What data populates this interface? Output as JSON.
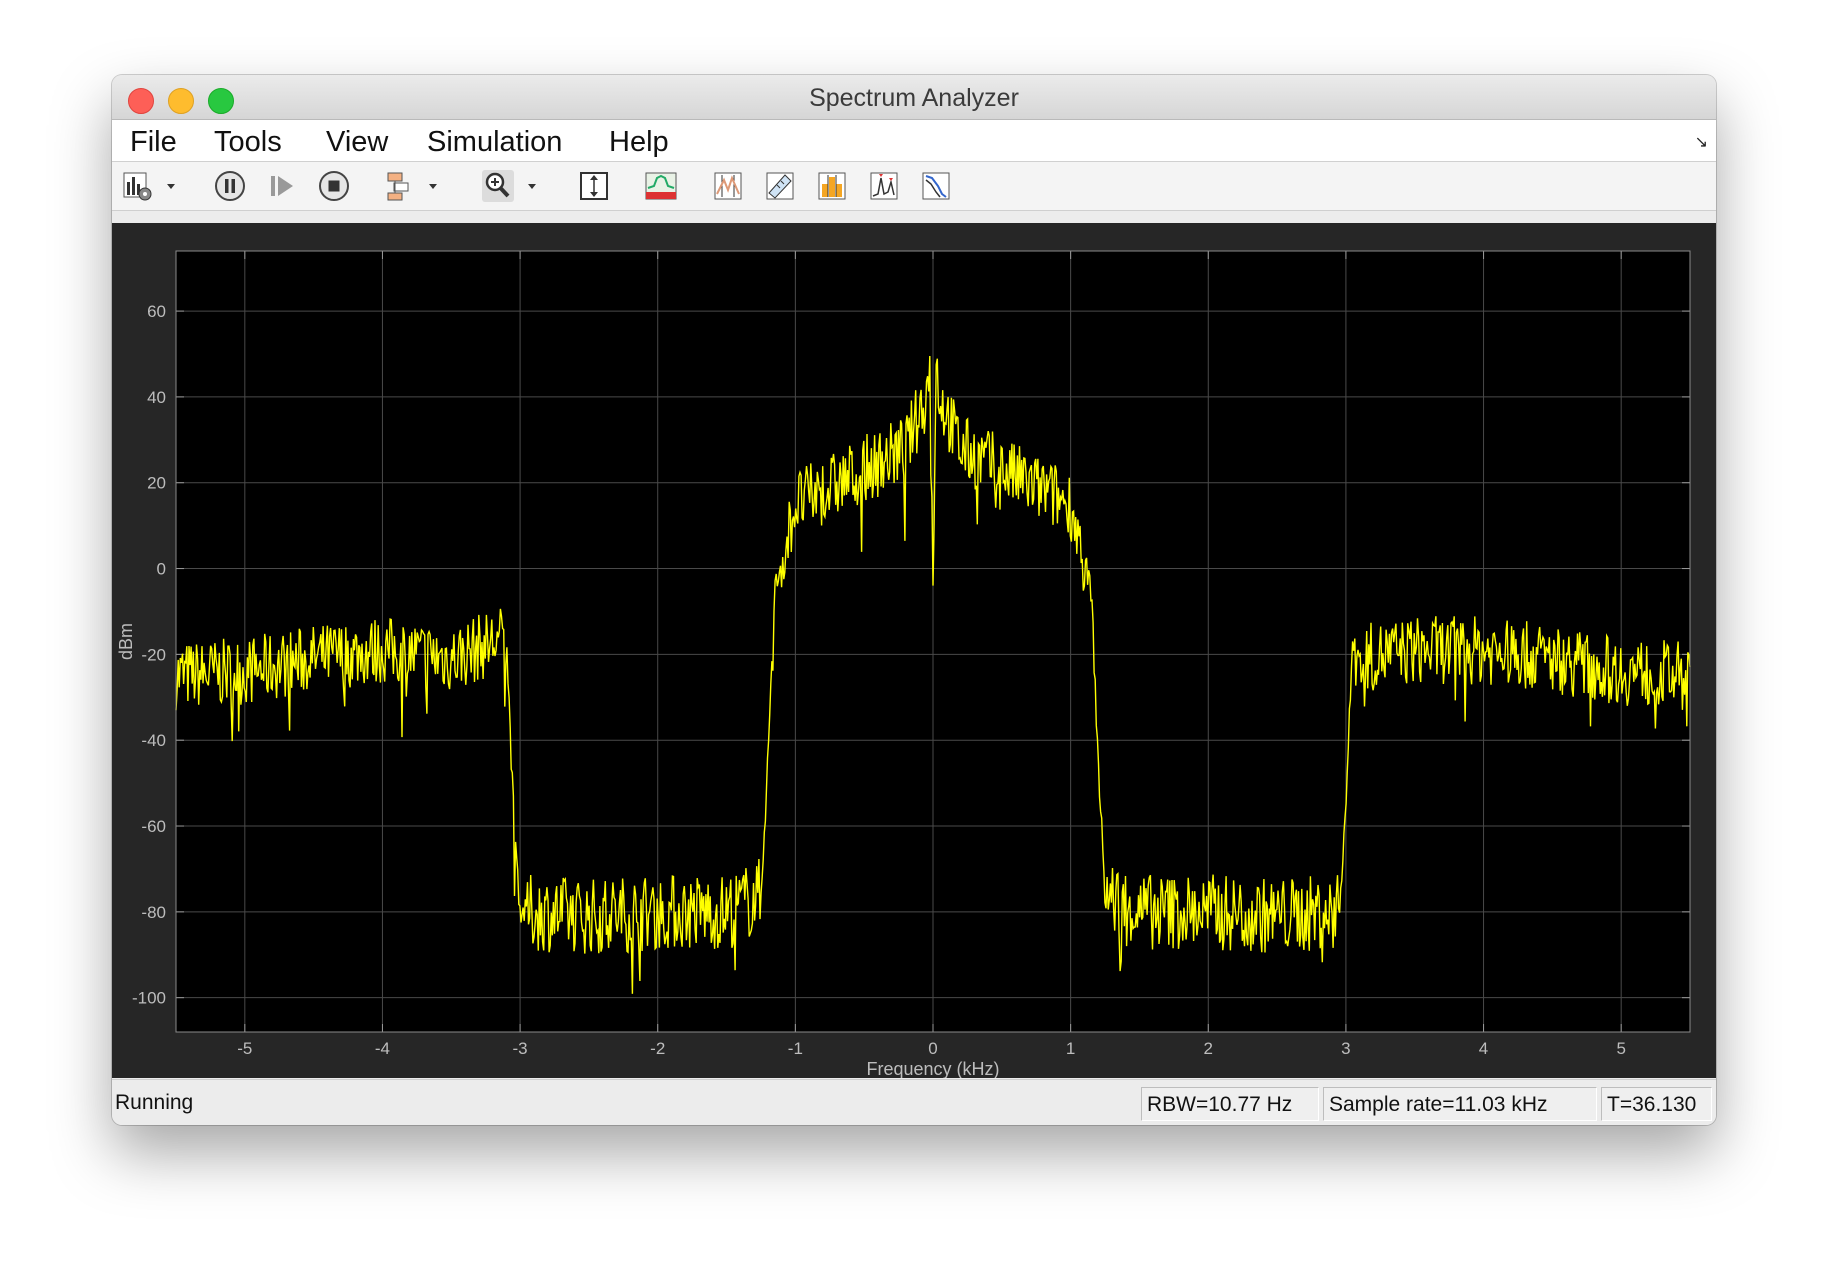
{
  "window": {
    "title": "Spectrum Analyzer"
  },
  "menu": {
    "items": [
      "File",
      "Tools",
      "View",
      "Simulation",
      "Help"
    ]
  },
  "toolbar": {
    "icons": [
      "spectrum-settings-icon",
      "dropdown-arrow-icon",
      "pause-icon",
      "step-forward-icon",
      "stop-icon",
      "highlight-blocks-icon",
      "dropdown-arrow-icon",
      "zoom-in-icon",
      "dropdown-arrow-icon",
      "scale-axes-icon",
      "spectrum-view-icon",
      "data-cursors-icon",
      "measurement-icon",
      "channel-measurements-icon",
      "peak-finder-icon",
      "ccdf-icon"
    ]
  },
  "status": {
    "state": "Running",
    "rbw": "RBW=10.77 Hz",
    "sample_rate": "Sample rate=11.03 kHz",
    "time": "T=36.130"
  },
  "colors": {
    "trace": "#ffff00",
    "plot_background": "#000000",
    "panel_background": "#262626",
    "grid": "#4a4a4a",
    "tick_text": "#bdbdbd"
  },
  "chart_data": {
    "type": "line",
    "xlabel": "Frequency (kHz)",
    "ylabel": "dBm",
    "xlim": [
      -5.5,
      5.5
    ],
    "ylim": [
      -108,
      74
    ],
    "xticks": [
      -5,
      -4,
      -3,
      -2,
      -1,
      0,
      1,
      2,
      3,
      4,
      5
    ],
    "yticks": [
      60,
      40,
      20,
      0,
      -20,
      -40,
      -60,
      -80,
      -100
    ],
    "grid": true,
    "series": [
      {
        "x": [
          -5.5,
          -5.0,
          -4.5,
          -4.0,
          -3.5,
          -3.1,
          -3.05,
          -3.0,
          -2.5,
          -2.0,
          -1.5,
          -1.25,
          -1.2,
          -1.15,
          -1.0,
          -0.8,
          -0.5,
          -0.2,
          -0.05,
          -0.02,
          0.0,
          0.02,
          0.05,
          0.2,
          0.5,
          0.8,
          1.0,
          1.15,
          1.2,
          1.25,
          1.5,
          2.0,
          2.5,
          2.95,
          3.0,
          3.05,
          3.1,
          3.5,
          4.0,
          4.5,
          5.0,
          5.5
        ],
        "y": [
          -25,
          -24,
          -21,
          -19,
          -21,
          -16,
          -55,
          -80,
          -81,
          -80,
          -80,
          -76,
          -45,
          -5,
          15,
          18,
          23,
          28,
          40,
          48,
          -6,
          48,
          40,
          28,
          23,
          18,
          15,
          -5,
          -45,
          -76,
          -80,
          -80,
          -81,
          -80,
          -55,
          -16,
          -21,
          -19,
          -19,
          -21,
          -24,
          -25
        ]
      }
    ]
  }
}
